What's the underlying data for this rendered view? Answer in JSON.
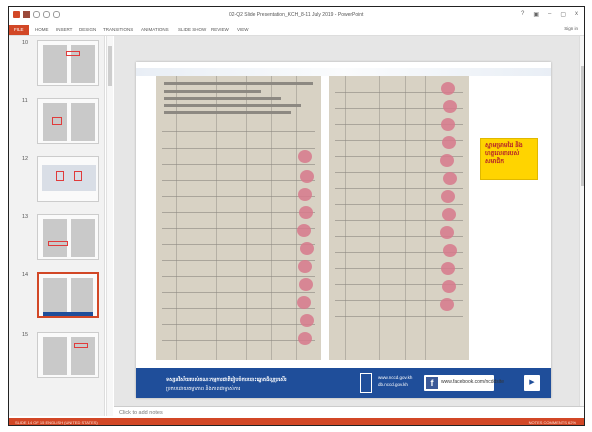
{
  "window": {
    "title": "02-Q2 Slide Presentation_KCH_8-11 July 2019 - PowerPoint",
    "controls": [
      "?",
      "▣",
      "–",
      "▢",
      "x"
    ]
  },
  "ribbon": {
    "tabs": [
      "FILE",
      "HOME",
      "INSERT",
      "DESIGN",
      "TRANSITIONS",
      "ANIMATIONS",
      "SLIDE SHOW",
      "REVIEW",
      "VIEW"
    ],
    "sign_in": "Sign in"
  },
  "thumbnails": [
    {
      "number": "10"
    },
    {
      "number": "11"
    },
    {
      "number": "12"
    },
    {
      "number": "13"
    },
    {
      "number": "14",
      "active": true
    },
    {
      "number": "15"
    }
  ],
  "slide": {
    "callout": "ស្នាមម្រាមដៃ និងហត្ថលេខារបស់សមាជិក",
    "footer_line1": "ទស្សនវិស័យរបស់គណៈកម្មការជាតិរៀបចំការបោះឆ្នោតដ៏ល្អប្រសើរ",
    "footer_line2": "ប្រកបដោយតម្លាភាព និងភាពជាម្ចាស់ការ",
    "url1": "www.nccd.gov.kh",
    "url2": "db.nccd.gov.kh",
    "facebook": "www.facebook.com/ncddsite"
  },
  "notes_placeholder": "Click to add notes",
  "status_bar": {
    "left": "SLIDE 14 OF 15   ENGLISH (UNITED STATES)",
    "right": "NOTES   COMMENTS   62%"
  }
}
